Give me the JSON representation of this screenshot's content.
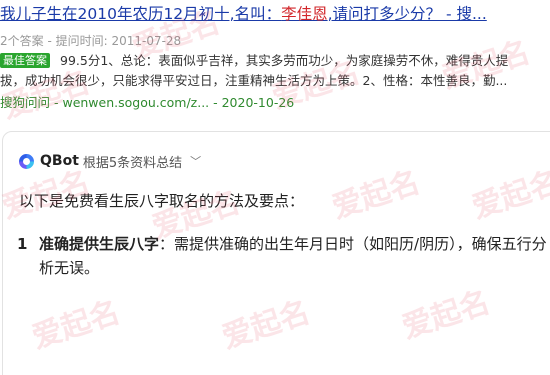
{
  "result": {
    "title_prefix": "我儿子生在2010年农历12月初十,名叫：",
    "title_name": "李佳恩",
    "title_suffix": ",请问打多少分？ - 搜...",
    "meta": "2个答案 - 提问时间: 2011-07-28",
    "badge": "最佳答案",
    "snippet_line1": "99.5分1、总论：表面似乎吉祥，其实多劳而功少，为家庭操劳不休，难得贵人提",
    "snippet_line2": "拔，成功机会很少，只能求得平安过日，注重精神生活方为上策。2、性格：本性善良，勤...",
    "source_name": "搜狗问问",
    "source_rest": " - wenwen.sogou.com/z... - 2020-10-26"
  },
  "qbot": {
    "name": "QBot",
    "desc": "根据5条资料总结",
    "chevron": "﹀",
    "intro": "以下是免费看生辰八字取名的方法及要点：",
    "items": [
      {
        "num": "1",
        "term": "准确提供生辰八字",
        "text": "：需提供准确的出生年月日时（如阳历/阴历），确保五行分析无误。"
      }
    ]
  },
  "watermark": "爱起名",
  "colors": {
    "link": "#1a3aa8",
    "highlight": "#d2272b",
    "badge": "#2aa52e",
    "source": "#2f8a2f",
    "watermark": "#e8566a"
  }
}
